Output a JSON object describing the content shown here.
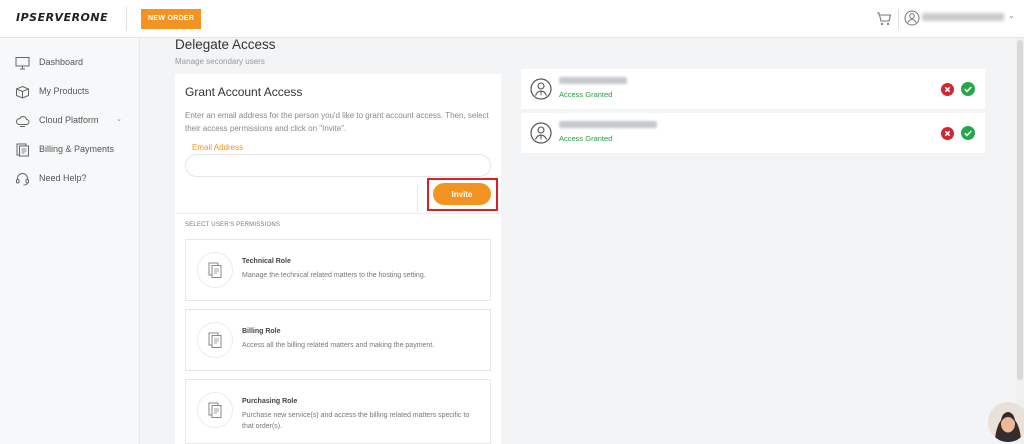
{
  "brand": {
    "logo_text": "IPSERVERONE",
    "accent_color": "#f39422"
  },
  "topbar": {
    "new_order_label": "NEW ORDER",
    "cart_icon": "cart-icon",
    "user_icon": "user-circle-icon",
    "user_menu_icon": "chevron-down-icon"
  },
  "sidebar": {
    "items": [
      {
        "label": "Dashboard",
        "icon": "monitor-icon"
      },
      {
        "label": "My Products",
        "icon": "box-icon"
      },
      {
        "label": "Cloud Platform",
        "icon": "cloud-icon",
        "has_submenu": true
      },
      {
        "label": "Billing & Payments",
        "icon": "billing-icon"
      },
      {
        "label": "Need Help?",
        "icon": "headset-icon"
      }
    ]
  },
  "page": {
    "title": "Delegate Access",
    "subtitle": "Manage secondary users"
  },
  "grant": {
    "title": "Grant Account Access",
    "description": "Enter an email address for the person you'd like to grant account access. Then, select their access permissions and click on \"Invite\".",
    "email_label": "Email Address",
    "email_value": "",
    "invite_label": "Invite",
    "permissions_heading": "SELECT USER'S PERMISSIONS",
    "permissions": [
      {
        "title": "Technical Role",
        "description": "Manage the technical related matters to the hosting setting.",
        "icon": "document-icon"
      },
      {
        "title": "Billing Role",
        "description": "Access all the billing related matters and making the payment.",
        "icon": "document-icon"
      },
      {
        "title": "Purchasing Role",
        "description": "Purchase new service(s) and access the billing related matters specific to that order(s).",
        "icon": "document-icon"
      }
    ]
  },
  "access_list": [
    {
      "status": "Access Granted",
      "name_redacted": true
    },
    {
      "status": "Access Granted",
      "name_redacted": true
    }
  ],
  "colors": {
    "granted": "#22a33d",
    "remove": "#d3262e",
    "approve": "#25a74b",
    "highlight": "#e01e26"
  }
}
